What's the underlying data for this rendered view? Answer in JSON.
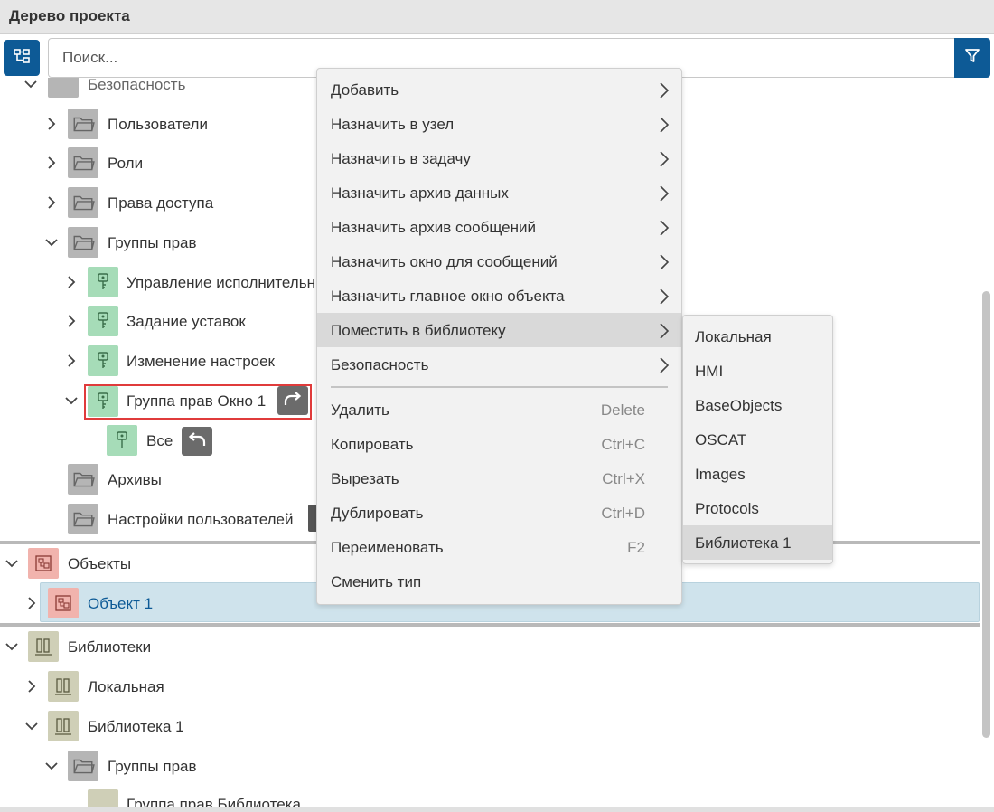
{
  "header": {
    "title": "Дерево проекта"
  },
  "search": {
    "placeholder": "Поиск..."
  },
  "tree": {
    "security": "Безопасность",
    "users": "Пользователи",
    "roles": "Роли",
    "access_rights": "Права доступа",
    "rights_groups": "Группы прав",
    "manage_exec": "Управление исполнительн",
    "setpoints": "Задание уставок",
    "settings_change": "Изменение настроек",
    "group_window1": "Группа прав Окно 1",
    "all": "Все",
    "archives": "Архивы",
    "user_settings": "Настройки пользователей",
    "objects": "Объекты",
    "object1": "Объект 1",
    "libraries": "Библиотеки",
    "lib_local": "Локальная",
    "library1": "Библиотека 1",
    "lib_rights_groups": "Группы прав",
    "lib_group": "Группа прав Библиотека"
  },
  "context_menu": {
    "items": [
      {
        "label": "Добавить",
        "submenu": true
      },
      {
        "label": "Назначить в узел",
        "submenu": true
      },
      {
        "label": "Назначить в задачу",
        "submenu": true
      },
      {
        "label": "Назначить архив данных",
        "submenu": true
      },
      {
        "label": "Назначить архив сообщений",
        "submenu": true
      },
      {
        "label": "Назначить окно для сообщений",
        "submenu": true
      },
      {
        "label": "Назначить главное окно объекта",
        "submenu": true
      },
      {
        "label": "Поместить в библиотеку",
        "submenu": true,
        "active": true
      },
      {
        "label": "Безопасность",
        "submenu": true
      }
    ],
    "actions": [
      {
        "label": "Удалить",
        "shortcut": "Delete"
      },
      {
        "label": "Копировать",
        "shortcut": "Ctrl+C"
      },
      {
        "label": "Вырезать",
        "shortcut": "Ctrl+X"
      },
      {
        "label": "Дублировать",
        "shortcut": "Ctrl+D"
      },
      {
        "label": "Переименовать",
        "shortcut": "F2"
      },
      {
        "label": "Сменить тип",
        "shortcut": ""
      }
    ]
  },
  "library_submenu": {
    "items": [
      "Локальная",
      "HMI",
      "BaseObjects",
      "OSCAT",
      "Images",
      "Protocols",
      "Библиотека 1"
    ],
    "active_index": 6
  },
  "icons": {
    "tree_button": "hierarchy-icon",
    "filter": "filter-icon",
    "folder": "folder-icon",
    "key": "key-icon",
    "object": "object-icon",
    "library": "library-icon"
  },
  "colors": {
    "accent": "#0d5a96",
    "selection": "#cfe3ec",
    "highlight": "#e03b3b",
    "folder_icon": "#b5b5b5",
    "key_icon": "#a6dcb8",
    "object_icon": "#f1b3ad",
    "library_icon": "#cfcfb7"
  }
}
